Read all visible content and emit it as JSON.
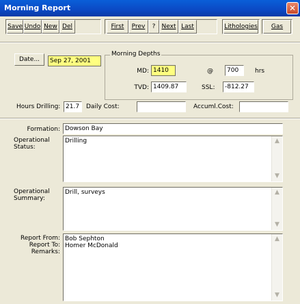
{
  "window": {
    "title": "Morning Report",
    "close_glyph": "✕"
  },
  "toolbar": {
    "save": "Save",
    "undo": "Undo",
    "new": "New",
    "del": "Del",
    "first": "First",
    "prev": "Prev",
    "help": "?",
    "next": "Next",
    "last": "Last",
    "lithologies": "Lithologies",
    "gas": "Gas"
  },
  "date": {
    "button": "Date...",
    "value": "Sep 27, 2001"
  },
  "morning_depths": {
    "group_label": "Morning Depths",
    "md_label": "MD:",
    "md_value": "1410",
    "at_label": "@",
    "time_value": "700",
    "time_unit": "hrs",
    "tvd_label": "TVD:",
    "tvd_value": "1409.87",
    "ssl_label": "SSL:",
    "ssl_value": "-812.27"
  },
  "costs": {
    "hours_label": "Hours Drilling:",
    "hours_value": "21.7",
    "daily_label": "Daily Cost:",
    "daily_value": "",
    "accum_label": "Accuml.Cost:",
    "accum_value": ""
  },
  "details": {
    "formation_label": "Formation:",
    "formation_value": "Dowson Bay",
    "status_label": "Operational\nStatus:",
    "status_value": "Drilling",
    "summary_label": "Operational\nSummary:",
    "summary_value": "Drill, surveys",
    "report_labels": "Report From:\nReport To:\nRemarks:",
    "report_value": "Bob Sephton\nHomer McDonald"
  },
  "icons": {
    "scroll_up": "scroll-up-arrow-icon",
    "scroll_down": "scroll-down-arrow-icon",
    "close": "close-icon"
  },
  "colors": {
    "highlight": "#ffff80",
    "titlebar": "#0b49c4",
    "face": "#ece9d8"
  }
}
